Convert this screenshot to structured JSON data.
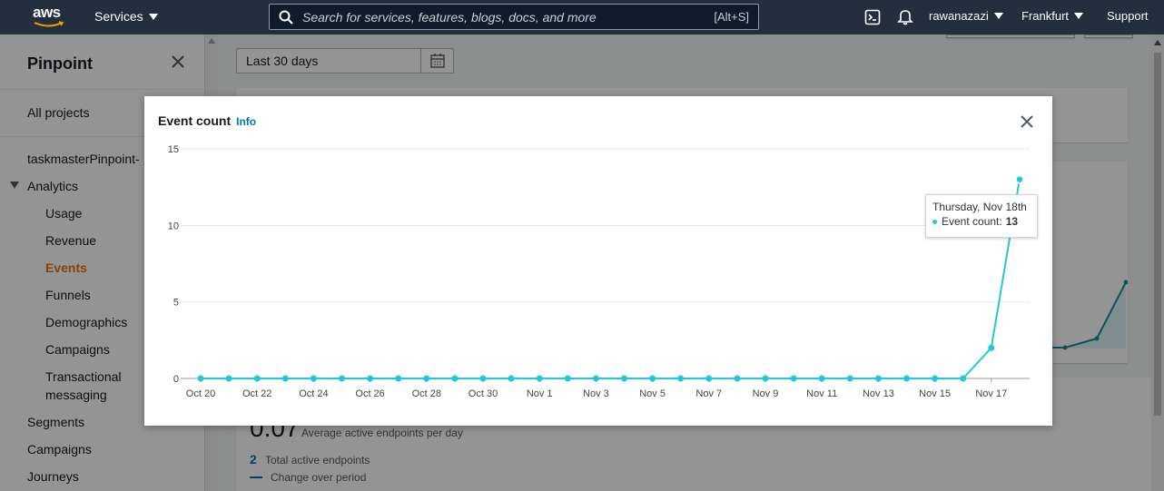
{
  "topnav": {
    "logo": "aws",
    "services_label": "Services",
    "search_placeholder": "Search for services, features, blogs, docs, and more",
    "search_shortcut": "[Alt+S]",
    "user": "rawanazazi",
    "region": "Frankfurt",
    "support": "Support"
  },
  "sidebar": {
    "title": "Pinpoint",
    "all_projects": "All projects",
    "project": "taskmasterPinpoint-",
    "analytics": "Analytics",
    "analytics_items": [
      "Usage",
      "Revenue",
      "Events",
      "Funnels",
      "Demographics",
      "Campaigns",
      "Transactional",
      "messaging"
    ],
    "other_items": [
      "Segments",
      "Campaigns",
      "Journeys"
    ],
    "active_item": "Events"
  },
  "main": {
    "date_range": "Last 30 days",
    "bg_big_value": "0.07",
    "bg_big_label": "Average active endpoints per day",
    "bg_total_value": "2",
    "bg_total_label": "Total active endpoints",
    "bg_change_label": "Change over period"
  },
  "modal": {
    "title": "Event count",
    "info_link": "Info",
    "tooltip_date": "Thursday, Nov 18th",
    "tooltip_series": "Event count:",
    "tooltip_value": "13"
  },
  "colors": {
    "series": "#24c6dc",
    "nav_bg": "#232f3e",
    "active": "#ec7211",
    "link": "#0073bb"
  },
  "chart_data": {
    "type": "line",
    "x_dates": [
      "Oct 20",
      "Oct 21",
      "Oct 22",
      "Oct 23",
      "Oct 24",
      "Oct 25",
      "Oct 26",
      "Oct 27",
      "Oct 28",
      "Oct 29",
      "Oct 30",
      "Oct 31",
      "Nov 1",
      "Nov 2",
      "Nov 3",
      "Nov 4",
      "Nov 5",
      "Nov 6",
      "Nov 7",
      "Nov 8",
      "Nov 9",
      "Nov 10",
      "Nov 11",
      "Nov 12",
      "Nov 13",
      "Nov 14",
      "Nov 15",
      "Nov 16",
      "Nov 17",
      "Nov 18"
    ],
    "x_tick_labels": [
      "Oct 20",
      "Oct 22",
      "Oct 24",
      "Oct 26",
      "Oct 28",
      "Oct 30",
      "Nov 1",
      "Nov 3",
      "Nov 5",
      "Nov 7",
      "Nov 9",
      "Nov 11",
      "Nov 13",
      "Nov 15",
      "Nov 17"
    ],
    "series": [
      {
        "values": [
          0,
          0,
          0,
          0,
          0,
          0,
          0,
          0,
          0,
          0,
          0,
          0,
          0,
          0,
          0,
          0,
          0,
          0,
          0,
          0,
          0,
          0,
          0,
          0,
          0,
          0,
          0,
          0,
          2,
          13
        ]
      }
    ],
    "y_ticks": [
      0,
      5,
      10,
      15
    ],
    "ylim": [
      0,
      15
    ],
    "grid": true,
    "legend": "none"
  }
}
